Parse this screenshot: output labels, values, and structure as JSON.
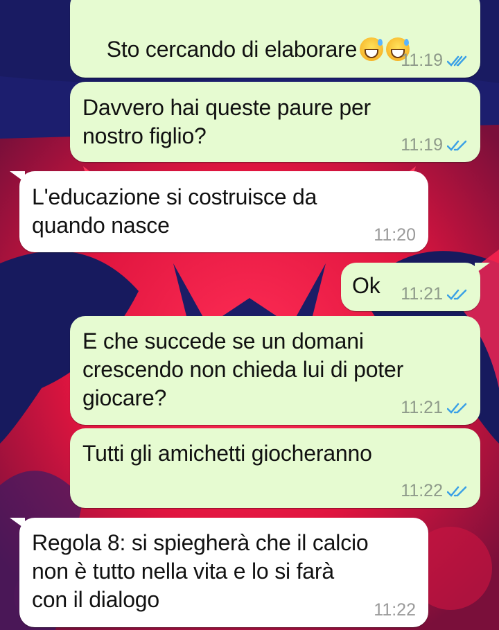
{
  "chat": {
    "messages": [
      {
        "direction": "out",
        "text": "Sto cercando di elaborare",
        "emoji": [
          "grinning-sweat-emoji",
          "grinning-sweat-emoji"
        ],
        "time": "11:19",
        "status": "read"
      },
      {
        "direction": "out",
        "text": "Davvero hai queste paure per\nnostro figlio?",
        "time": "11:19",
        "status": "read"
      },
      {
        "direction": "in",
        "text": "L'educazione si costruisce da\nquando nasce",
        "time": "11:20"
      },
      {
        "direction": "out",
        "text": "Ok",
        "time": "11:21",
        "status": "read"
      },
      {
        "direction": "out",
        "text": "E che succede se un domani\ncrescendo non chieda lui di poter\ngiocare?",
        "time": "11:21",
        "status": "read"
      },
      {
        "direction": "out",
        "text": "Tutti gli amichetti giocheranno",
        "time": "11:22",
        "status": "read"
      },
      {
        "direction": "in",
        "text": "Regola 8: si spiegherà che il calcio\nnon è tutto nella vita e lo si farà\ncon il dialogo",
        "time": "11:22"
      }
    ]
  },
  "colors": {
    "outgoing_bubble": "#e6fbd1",
    "incoming_bubble": "#ffffff",
    "read_tick": "#3aa0e6",
    "wallpaper_navy": "#1a1f6b",
    "wallpaper_red": "#e8234a"
  }
}
